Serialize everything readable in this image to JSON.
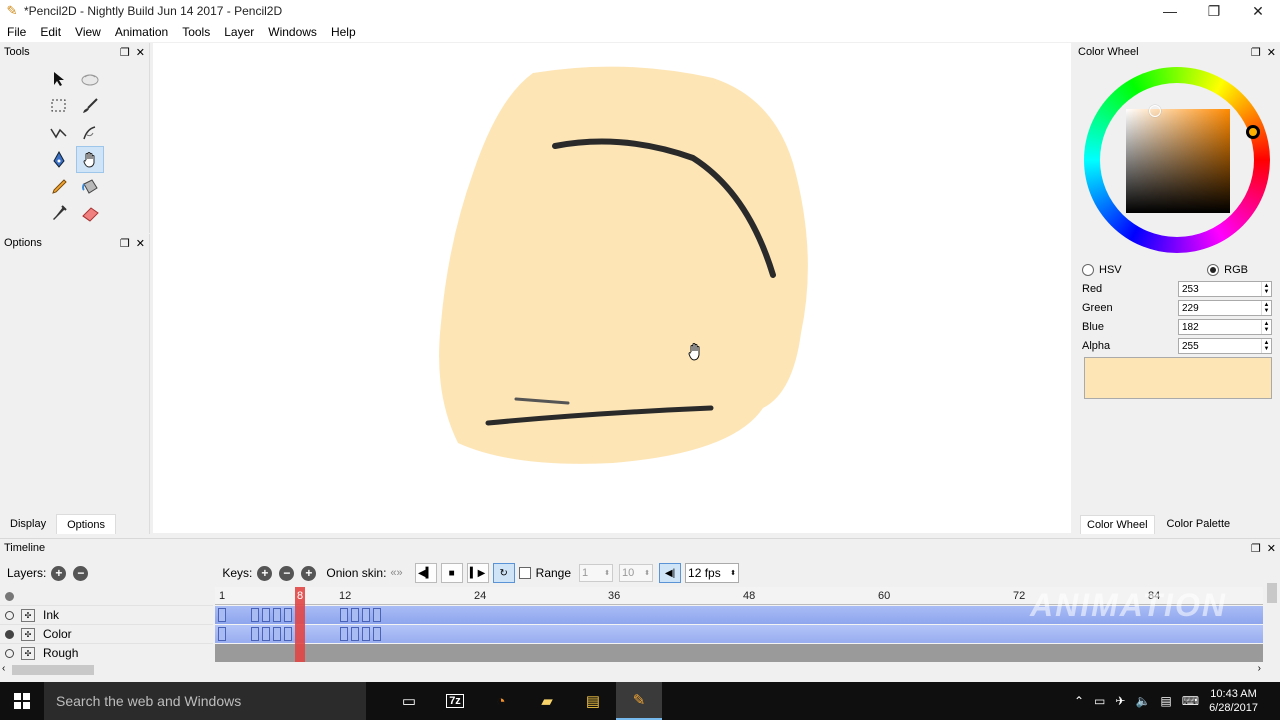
{
  "window": {
    "title": "*Pencil2D - Nightly Build Jun 14 2017 - Pencil2D"
  },
  "menu": [
    "File",
    "Edit",
    "View",
    "Animation",
    "Tools",
    "Layer",
    "Windows",
    "Help"
  ],
  "tools_panel": {
    "title": "Tools"
  },
  "options_panel": {
    "title": "Options"
  },
  "left_tabs": [
    "Display",
    "Options"
  ],
  "color_panel": {
    "title": "Color Wheel",
    "modes": [
      "HSV",
      "RGB"
    ],
    "selected_mode": "RGB",
    "fields": [
      {
        "label": "Red",
        "value": "253"
      },
      {
        "label": "Green",
        "value": "229"
      },
      {
        "label": "Blue",
        "value": "182"
      },
      {
        "label": "Alpha",
        "value": "255"
      }
    ],
    "swatch_color": "#fde5b6",
    "tabs": [
      "Color Wheel",
      "Color Palette"
    ]
  },
  "timeline": {
    "title": "Timeline",
    "layers_label": "Layers:",
    "keys_label": "Keys:",
    "onion_label": "Onion skin:",
    "range_label": "Range",
    "range_start": "1",
    "range_end": "10",
    "fps": "12 fps",
    "ruler": [
      "1",
      "12",
      "24",
      "36",
      "48",
      "60",
      "72",
      "84"
    ],
    "current_frame": "8",
    "layers": [
      {
        "name": "Ink",
        "visible": false
      },
      {
        "name": "Color",
        "visible": true
      },
      {
        "name": "Rough",
        "visible": false
      }
    ]
  },
  "watermark": {
    "line1": "ANIMATION"
  },
  "taskbar": {
    "search_placeholder": "Search the web and Windows",
    "apps": [
      "task-view-icon",
      "7zip-icon",
      "blender-icon",
      "folder-icon",
      "file-explorer-icon",
      "pencil2d-icon"
    ],
    "time": "10:43 AM",
    "date": "6/28/2017"
  },
  "colors": {
    "accent": "#cfe4f7",
    "fill": "#fde5b6",
    "playhead": "#e24646",
    "track": "#98adf0"
  }
}
